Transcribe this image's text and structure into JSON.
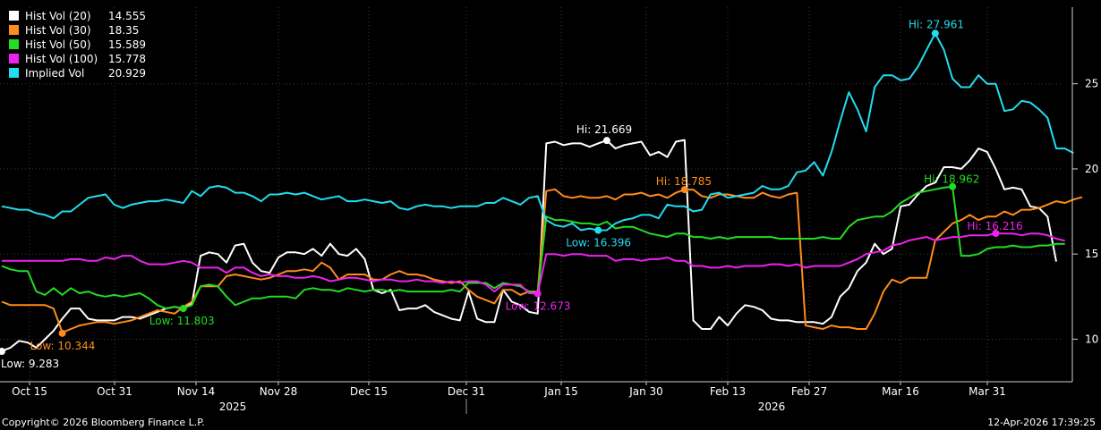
{
  "chart_data": {
    "type": "line",
    "y_ticks": [
      10,
      15,
      20,
      25
    ],
    "ylim": [
      7.5,
      29.5
    ],
    "x_tick_labels": [
      "Oct 15",
      "Oct 31",
      "Nov 14",
      "Nov 28",
      "Dec 15",
      "Dec 31",
      "Jan 15",
      "Jan 30",
      "Feb 13",
      "Feb 27",
      "Mar 16",
      "Mar 31"
    ],
    "year_labels": [
      "2025",
      "2026"
    ],
    "grid": true,
    "legend_position": "top-left",
    "series": [
      {
        "name": "Hist Vol (20)",
        "last": "14.555",
        "color": "#ffffff",
        "values": [
          9.3,
          9.5,
          9.9,
          9.8,
          9.5,
          10.0,
          10.5,
          11.2,
          11.8,
          11.8,
          11.2,
          11.1,
          11.1,
          11.1,
          11.3,
          11.3,
          11.2,
          11.4,
          11.6,
          11.8,
          11.9,
          11.8,
          12.1,
          14.9,
          15.1,
          15.0,
          14.5,
          15.5,
          15.6,
          14.5,
          14.0,
          13.9,
          14.8,
          15.1,
          15.1,
          15.0,
          15.3,
          14.9,
          15.6,
          15.0,
          14.9,
          15.3,
          14.7,
          12.9,
          12.7,
          12.9,
          11.7,
          11.8,
          11.8,
          12.0,
          11.6,
          11.4,
          11.2,
          11.1,
          12.8,
          11.2,
          11.0,
          11.0,
          12.9,
          12.2,
          12.0,
          11.6,
          11.5,
          21.5,
          21.6,
          21.4,
          21.5,
          21.5,
          21.3,
          21.5,
          21.669,
          21.2,
          21.4,
          21.5,
          21.6,
          20.8,
          21.0,
          20.7,
          21.6,
          21.7,
          11.1,
          10.6,
          10.6,
          11.3,
          10.8,
          11.5,
          12.0,
          11.9,
          11.7,
          11.2,
          11.1,
          11.1,
          11.0,
          11.0,
          11.0,
          10.9,
          11.3,
          12.5,
          13.0,
          14.0,
          14.5,
          15.6,
          15.0,
          15.3,
          17.8,
          17.9,
          18.5,
          19.0,
          19.2,
          20.1,
          20.1,
          20.0,
          20.5,
          21.2,
          21.0,
          20.0,
          18.8,
          18.9,
          18.8,
          17.8,
          17.7,
          17.2,
          14.555
        ]
      },
      {
        "name": "Hist Vol (30)",
        "last": "18.35",
        "color": "#ff8c1a",
        "values": [
          12.2,
          12.0,
          12.0,
          12.0,
          12.0,
          12.0,
          11.8,
          10.4,
          10.6,
          10.8,
          10.9,
          11.0,
          11.0,
          10.9,
          11.0,
          11.1,
          11.3,
          11.5,
          11.7,
          11.6,
          11.5,
          11.9,
          12.2,
          13.1,
          13.1,
          13.1,
          13.7,
          13.8,
          13.7,
          13.6,
          13.5,
          13.6,
          13.8,
          14.0,
          14.0,
          14.1,
          14.0,
          14.5,
          14.2,
          13.5,
          13.8,
          13.8,
          13.8,
          13.5,
          13.5,
          13.8,
          14.0,
          13.8,
          13.8,
          13.7,
          13.5,
          13.4,
          13.3,
          13.4,
          12.9,
          12.5,
          12.3,
          12.1,
          12.9,
          12.9,
          12.6,
          12.8,
          12.8,
          18.7,
          18.8,
          18.4,
          18.3,
          18.4,
          18.3,
          18.3,
          18.4,
          18.2,
          18.5,
          18.5,
          18.6,
          18.4,
          18.5,
          18.3,
          18.6,
          18.785,
          18.785,
          18.4,
          18.3,
          18.5,
          18.5,
          18.4,
          18.3,
          18.3,
          18.6,
          18.4,
          18.3,
          18.5,
          18.6,
          10.8,
          10.7,
          10.6,
          10.8,
          10.7,
          10.7,
          10.6,
          10.6,
          11.5,
          12.8,
          13.5,
          13.3,
          13.6,
          13.6,
          13.6,
          15.8,
          16.3,
          16.8,
          17.0,
          17.3,
          17.0,
          17.2,
          17.2,
          17.5,
          17.3,
          17.6,
          17.6,
          17.7,
          17.9,
          18.1,
          18.0,
          18.2,
          18.35
        ]
      },
      {
        "name": "Hist Vol (50)",
        "last": "15.589",
        "color": "#22dd22",
        "values": [
          14.3,
          14.1,
          14.0,
          14.0,
          12.8,
          12.6,
          13.0,
          12.6,
          13.0,
          12.7,
          12.8,
          12.6,
          12.5,
          12.6,
          12.5,
          12.6,
          12.7,
          12.4,
          12.0,
          11.8,
          11.9,
          11.803,
          12.0,
          13.1,
          13.2,
          13.1,
          12.5,
          12.0,
          12.2,
          12.4,
          12.4,
          12.5,
          12.5,
          12.5,
          12.4,
          12.9,
          13.0,
          12.9,
          12.9,
          12.8,
          13.0,
          12.9,
          12.8,
          12.9,
          12.9,
          12.8,
          12.9,
          12.8,
          12.8,
          12.8,
          12.8,
          12.8,
          12.9,
          12.8,
          13.3,
          13.3,
          13.3,
          13.0,
          13.3,
          13.2,
          13.1,
          12.8,
          12.7,
          17.2,
          17.0,
          17.0,
          16.9,
          16.8,
          16.8,
          16.7,
          16.9,
          16.5,
          16.6,
          16.6,
          16.4,
          16.2,
          16.1,
          16.0,
          16.2,
          16.2,
          16.0,
          16.0,
          15.9,
          16.0,
          15.9,
          16.0,
          16.0,
          16.0,
          16.0,
          16.0,
          15.9,
          15.9,
          15.9,
          15.9,
          15.9,
          16.0,
          15.9,
          15.9,
          16.6,
          17.0,
          17.1,
          17.2,
          17.2,
          17.5,
          18.0,
          18.3,
          18.6,
          18.7,
          18.8,
          18.9,
          18.962,
          14.9,
          14.9,
          15.0,
          15.3,
          15.4,
          15.4,
          15.5,
          15.4,
          15.4,
          15.5,
          15.5,
          15.6,
          15.589
        ]
      },
      {
        "name": "Hist Vol (100)",
        "last": "15.778",
        "color": "#ee22ee",
        "values": [
          14.6,
          14.6,
          14.6,
          14.6,
          14.6,
          14.6,
          14.6,
          14.6,
          14.7,
          14.7,
          14.6,
          14.6,
          14.8,
          14.7,
          14.9,
          14.9,
          14.6,
          14.4,
          14.4,
          14.4,
          14.5,
          14.6,
          14.5,
          14.2,
          14.2,
          14.2,
          13.9,
          14.2,
          14.2,
          13.9,
          13.7,
          13.8,
          13.7,
          13.7,
          13.6,
          13.6,
          13.7,
          13.6,
          13.4,
          13.5,
          13.6,
          13.6,
          13.5,
          13.4,
          13.5,
          13.5,
          13.4,
          13.4,
          13.5,
          13.4,
          13.4,
          13.3,
          13.4,
          13.3,
          13.4,
          13.4,
          13.2,
          12.8,
          13.2,
          13.2,
          13.2,
          12.7,
          12.673,
          15.0,
          15.0,
          14.9,
          15.0,
          15.0,
          14.9,
          14.9,
          14.9,
          14.6,
          14.7,
          14.7,
          14.6,
          14.7,
          14.7,
          14.8,
          14.6,
          14.6,
          14.3,
          14.3,
          14.2,
          14.2,
          14.3,
          14.2,
          14.3,
          14.3,
          14.3,
          14.4,
          14.4,
          14.3,
          14.4,
          14.2,
          14.3,
          14.3,
          14.3,
          14.3,
          14.5,
          14.7,
          15.0,
          15.1,
          15.2,
          15.5,
          15.6,
          15.8,
          15.9,
          16.0,
          15.8,
          15.9,
          16.0,
          16.0,
          16.1,
          16.1,
          16.1,
          16.216,
          16.2,
          16.2,
          16.1,
          16.2,
          16.2,
          16.1,
          15.9,
          15.778
        ]
      },
      {
        "name": "Implied Vol",
        "last": "20.929",
        "color": "#22ddee",
        "values": [
          17.8,
          17.7,
          17.6,
          17.6,
          17.4,
          17.3,
          17.1,
          17.5,
          17.5,
          17.9,
          18.3,
          18.4,
          18.5,
          17.9,
          17.7,
          17.9,
          18.0,
          18.1,
          18.1,
          18.2,
          18.1,
          18.0,
          18.7,
          18.4,
          18.9,
          19.0,
          18.9,
          18.6,
          18.6,
          18.4,
          18.1,
          18.5,
          18.5,
          18.6,
          18.5,
          18.6,
          18.4,
          18.2,
          18.3,
          18.4,
          18.1,
          18.1,
          18.2,
          18.1,
          18.0,
          18.1,
          17.7,
          17.6,
          17.8,
          17.9,
          17.8,
          17.8,
          17.7,
          17.8,
          17.8,
          17.8,
          18.0,
          18.0,
          18.3,
          18.1,
          17.9,
          18.3,
          18.4,
          17.0,
          16.7,
          16.6,
          16.8,
          16.4,
          16.5,
          16.396,
          16.4,
          16.8,
          17.0,
          17.1,
          17.3,
          17.3,
          17.1,
          17.9,
          17.8,
          17.8,
          17.5,
          17.6,
          18.5,
          18.6,
          18.3,
          18.4,
          18.5,
          18.6,
          19.0,
          18.8,
          18.8,
          19.0,
          19.8,
          19.9,
          20.4,
          19.6,
          21.0,
          22.8,
          24.5,
          23.5,
          22.2,
          24.8,
          25.5,
          25.5,
          25.2,
          25.3,
          26.0,
          27.0,
          27.961,
          27.0,
          25.3,
          24.8,
          24.8,
          25.5,
          25.0,
          25.0,
          23.4,
          23.5,
          24.0,
          23.9,
          23.5,
          23.0,
          21.2,
          21.2,
          20.929
        ]
      }
    ],
    "annotations": [
      {
        "series": 0,
        "label": "Low: 9.283",
        "index": 0,
        "value": 9.283
      },
      {
        "series": 0,
        "label": "Hi: 21.669",
        "index": 70,
        "value": 21.669
      },
      {
        "series": 1,
        "label": "Low: 10.344",
        "index": 7,
        "value": 10.344
      },
      {
        "series": 1,
        "label": "Hi: 18.785",
        "index": 79,
        "value": 18.785
      },
      {
        "series": 2,
        "label": "Low: 11.803",
        "index": 21,
        "value": 11.803
      },
      {
        "series": 2,
        "label": "Hi: 18.962",
        "index": 110,
        "value": 18.962
      },
      {
        "series": 3,
        "label": "Low: 12.673",
        "index": 62,
        "value": 12.673
      },
      {
        "series": 3,
        "label": "Hi: 16.216",
        "index": 115,
        "value": 16.216
      },
      {
        "series": 4,
        "label": "Low: 16.396",
        "index": 69,
        "value": 16.396
      },
      {
        "series": 4,
        "label": "Hi: 27.961",
        "index": 108,
        "value": 27.961
      }
    ]
  },
  "footer": {
    "copyright": "Copyright© 2026 Bloomberg Finance L.P.",
    "timestamp": "12-Apr-2026 17:39:25"
  }
}
